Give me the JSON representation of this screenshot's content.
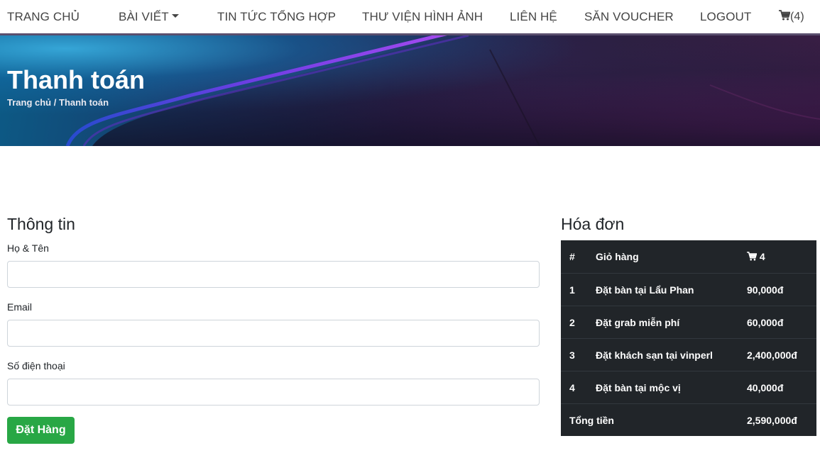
{
  "nav": {
    "home": "TRANG CHỦ",
    "posts": "BÀI VIẾT",
    "news": "TIN TỨC TỔNG HỢP",
    "gallery": "THƯ VIỆN HÌNH ẢNH",
    "contact": "LIÊN HỆ",
    "voucher": "SĂN VOUCHER",
    "logout": "LOGOUT",
    "cart_count": "(4)"
  },
  "hero": {
    "title": "Thanh toán",
    "breadcrumb_home": "Trang chủ",
    "breadcrumb_sep": "/",
    "breadcrumb_current": "Thanh toán"
  },
  "form": {
    "title": "Thông tin",
    "name_label": "Họ & Tên",
    "name_value": "",
    "email_label": "Email",
    "email_value": "",
    "phone_label": "Số điện thoại",
    "phone_value": "",
    "submit_label": "Đặt Hàng"
  },
  "invoice": {
    "title": "Hóa đơn",
    "header": {
      "num": "#",
      "item": "Giỏ hàng",
      "count": "4"
    },
    "rows": [
      {
        "num": "1",
        "item": "Đặt bàn tại Lẩu Phan",
        "price": "90,000đ"
      },
      {
        "num": "2",
        "item": "Đặt grab miễn phí",
        "price": "60,000đ"
      },
      {
        "num": "3",
        "item": "Đặt khách sạn tại vinperl",
        "price": "2,400,000đ"
      },
      {
        "num": "4",
        "item": "Đặt bàn tại mộc vị",
        "price": "40,000đ"
      }
    ],
    "total_label": "Tổng tiền",
    "total_value": "2,590,000đ"
  },
  "icons": {
    "cart": "cart-icon",
    "posts_dropdown": "caret-down-icon"
  }
}
